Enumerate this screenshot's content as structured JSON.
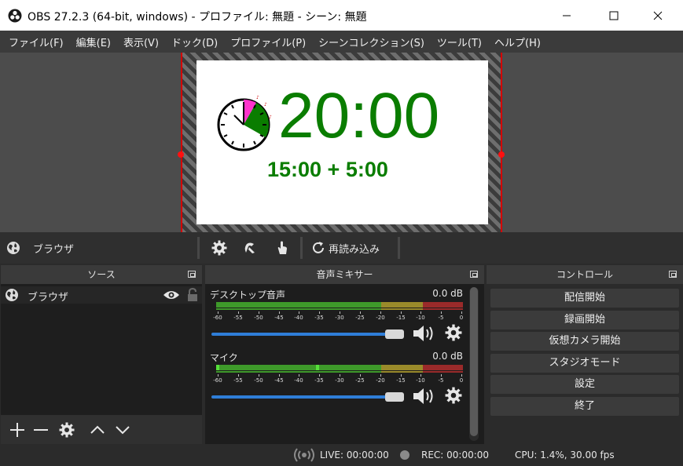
{
  "window": {
    "title": "OBS 27.2.3 (64-bit, windows) - プロファイル: 無題 - シーン: 無題",
    "app_icon": "obs-logo-icon",
    "controls": [
      "minimize-icon",
      "maximize-icon",
      "close-icon"
    ]
  },
  "menubar": {
    "items": [
      "ファイル(F)",
      "編集(E)",
      "表示(V)",
      "ドック(D)",
      "プロファイル(P)",
      "シーンコレクション(S)",
      "ツール(T)",
      "ヘルプ(H)"
    ]
  },
  "preview": {
    "main_time": "20:00",
    "sub_time": "15:00 + 5:00",
    "text_color": "#0a7d00",
    "clock_icon": "analog-clock-icon"
  },
  "source_toolbar": {
    "source_name": "ブラウザ",
    "reload_label": "再読み込み",
    "icons": [
      "globe-icon",
      "gear-icon",
      "interact-icon",
      "hand-icon",
      "reload-icon"
    ]
  },
  "sources": {
    "title": "ソース",
    "items": [
      {
        "name": "ブラウザ",
        "visible": true,
        "locked": false
      }
    ]
  },
  "mixer": {
    "title": "音声ミキサー",
    "channels": [
      {
        "name": "デスクトップ音声",
        "level": "0.0 dB"
      },
      {
        "name": "マイク",
        "level": "0.0 dB"
      }
    ],
    "ticks": [
      "-60",
      "-55",
      "-50",
      "-45",
      "-40",
      "-35",
      "-30",
      "-25",
      "-20",
      "-15",
      "-10",
      "-5",
      "0"
    ]
  },
  "controls": {
    "title": "コントロール",
    "buttons": [
      "配信開始",
      "録画開始",
      "仮想カメラ開始",
      "スタジオモード",
      "設定",
      "終了"
    ]
  },
  "statusbar": {
    "live": "LIVE: 00:00:00",
    "rec": "REC: 00:00:00",
    "cpu": "CPU: 1.4%, 30.00 fps"
  },
  "colors": {
    "meter_green": "#3e9a2a",
    "meter_yellow": "#9a8a2a",
    "meter_red": "#9a2a2a",
    "slider_blue": "#2f7ed8"
  }
}
